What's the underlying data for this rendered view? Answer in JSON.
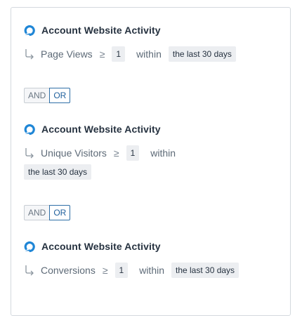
{
  "colors": {
    "logo": "#1f86d6",
    "or_active": "#2e6fa7",
    "chip_bg": "#eceef1"
  },
  "icons": {
    "logo": "account-logo-icon",
    "branch": "branch-arrow-icon"
  },
  "conditions": [
    {
      "title": "Account Website Activity",
      "metric": "Page Views",
      "operator": "≥",
      "value": "1",
      "within": "within",
      "range": "the last 30 days"
    },
    {
      "title": "Account Website Activity",
      "metric": "Unique Visitors",
      "operator": "≥",
      "value": "1",
      "within": "within",
      "range": "the last 30 days"
    },
    {
      "title": "Account Website Activity",
      "metric": "Conversions",
      "operator": "≥",
      "value": "1",
      "within": "within",
      "range": "the last 30 days"
    }
  ],
  "toggles": [
    {
      "and_label": "AND",
      "or_label": "OR",
      "selected": "OR"
    },
    {
      "and_label": "AND",
      "or_label": "OR",
      "selected": "OR"
    }
  ]
}
